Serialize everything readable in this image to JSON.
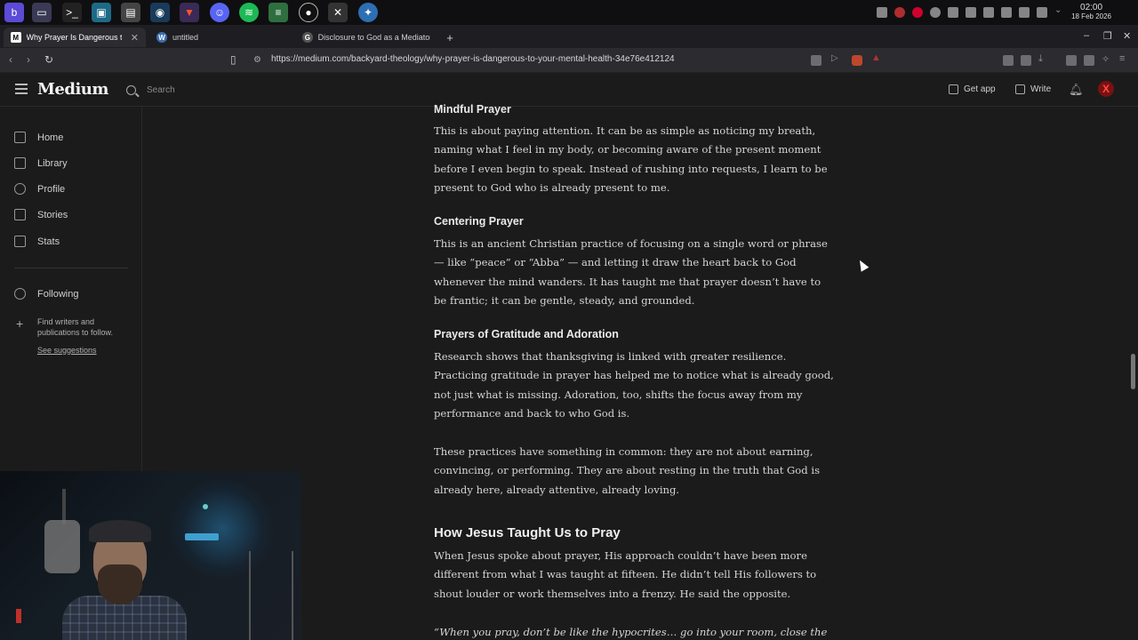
{
  "taskbar": {
    "apps": [
      "proton-app",
      "files-app",
      "terminal-app",
      "image-editor-app",
      "calendar-app",
      "steam-app",
      "brave-app",
      "discord-app",
      "spotify-app",
      "stack-app",
      "obs-app",
      "tools-app",
      "vs-app"
    ],
    "clock_time": "02:00",
    "clock_date": "18 Feb 2026"
  },
  "tabs": [
    {
      "label": "Why Prayer Is Dangerous to",
      "favicon": "M"
    },
    {
      "label": "untitled",
      "favicon": "W"
    },
    {
      "label": "Disclosure to God as a Mediator",
      "favicon": "G"
    }
  ],
  "address_bar": {
    "url": "https://medium.com/backyard-theology/why-prayer-is-dangerous-to-your-mental-health-34e76e412124"
  },
  "medium_header": {
    "logo": "Medium",
    "search_placeholder": "Search",
    "get_app": "Get app",
    "write": "Write",
    "avatar_letter": "X"
  },
  "sidebar": {
    "items": [
      {
        "label": "Home"
      },
      {
        "label": "Library"
      },
      {
        "label": "Profile"
      },
      {
        "label": "Stories"
      },
      {
        "label": "Stats"
      }
    ],
    "following": "Following",
    "find_writers": "Find writers and publications to follow.",
    "see_suggestions": "See suggestions"
  },
  "article": {
    "h_mindful": "Mindful Prayer",
    "p_mindful": "This is about paying attention. It can be as simple as noticing my breath, naming what I feel in my body, or becoming aware of the present moment before I even begin to speak. Instead of rushing into requests, I learn to be present to God who is already present to me.",
    "h_centering": "Centering Prayer",
    "p_centering": "This is an ancient Christian practice of focusing on a single word or phrase — like “peace” or “Abba” — and letting it draw the heart back to God whenever the mind wanders. It has taught me that prayer doesn’t have to be frantic; it can be gentle, steady, and grounded.",
    "h_gratitude": "Prayers of Gratitude and Adoration",
    "p_gratitude": "Research shows that thanksgiving is linked with greater resilience. Practicing gratitude in prayer has helped me to notice what is already good, not just what is missing. Adoration, too, shifts the focus away from my performance and back to who God is.",
    "p_common": "These practices have something in common: they are not about earning, convincing, or performing. They are about resting in the truth that God is already here, already attentive, already loving.",
    "h_jesus": "How Jesus Taught Us to Pray",
    "p_jesus": "When Jesus spoke about prayer, His approach couldn’t have been more different from what I was taught at fifteen. He didn’t tell His followers to shout louder or work themselves into a frenzy. He said the opposite.",
    "p_quote": "“When you pray, don’t be like the hypocrites… go into your room, close the door"
  }
}
